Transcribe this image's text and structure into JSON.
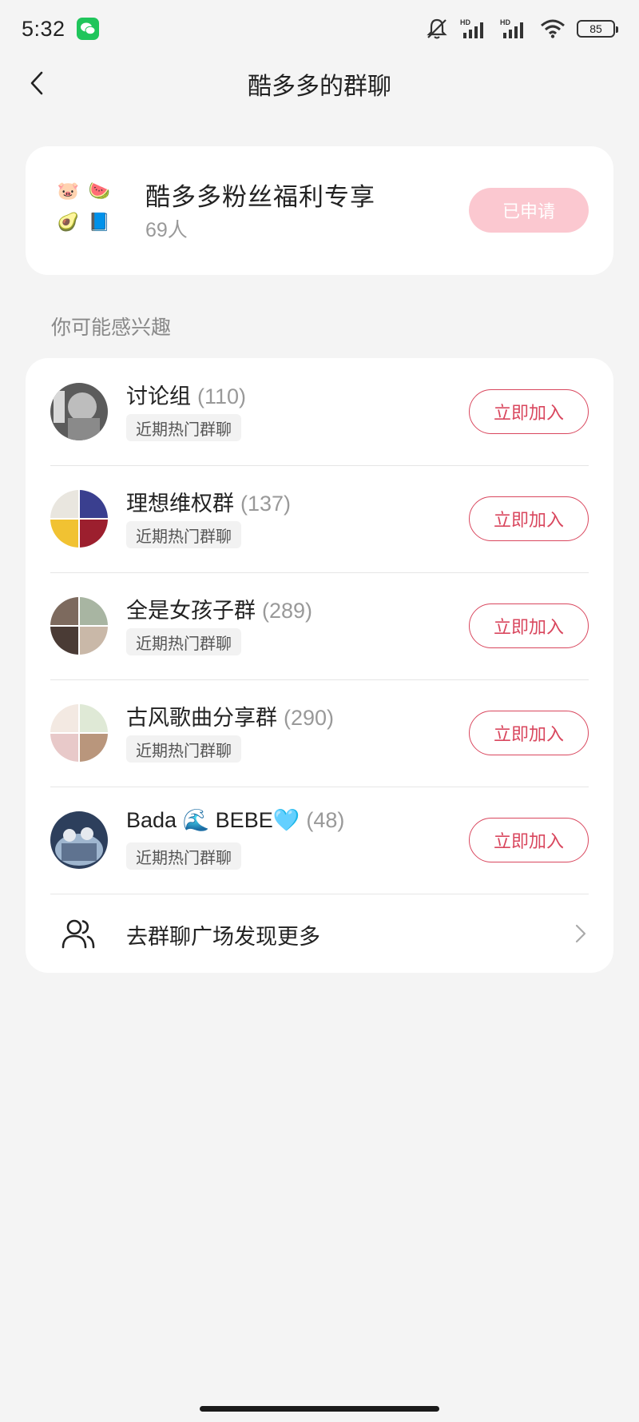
{
  "status_bar": {
    "time": "5:32",
    "battery": "85",
    "signal_1_label": "HD",
    "signal_2_label": "HD"
  },
  "header": {
    "title": "酷多多的群聊"
  },
  "my_group": {
    "name": "酷多多粉丝福利专享",
    "count": "69人",
    "button_label": "已申请",
    "mosaic": [
      "🐷",
      "🍉",
      "🥑",
      "📘"
    ]
  },
  "section_label": "你可能感兴趣",
  "groups": [
    {
      "name": "讨论组",
      "count": "(110)",
      "tag": "近期热门群聊",
      "button_label": "立即加入",
      "avatar_colors": [
        "#5b5b5b",
        "#bdbdbd",
        "#8a8a8a",
        "#d8d8d8"
      ]
    },
    {
      "name": "理想维权群",
      "count": "(137)",
      "tag": "近期热门群聊",
      "button_label": "立即加入",
      "avatar_colors": [
        "#e9e6df",
        "#3a3f8f",
        "#f1c232",
        "#9c1f2e"
      ]
    },
    {
      "name": "全是女孩子群",
      "count": "(289)",
      "tag": "近期热门群聊",
      "button_label": "立即加入",
      "avatar_colors": [
        "#7d6a5e",
        "#a8b5a2",
        "#4a3b35",
        "#c9b8a8"
      ]
    },
    {
      "name": "古风歌曲分享群",
      "count": "(290)",
      "tag": "近期热门群聊",
      "button_label": "立即加入",
      "avatar_colors": [
        "#f3e9e2",
        "#dfe9d6",
        "#e8c9c9",
        "#b9967c"
      ]
    },
    {
      "name": "Bada 🌊 BEBE🩵",
      "count": "(48)",
      "tag": "近期热门群聊",
      "button_label": "立即加入",
      "avatar_colors": [
        "#2d3f5c",
        "#9fb6cf",
        "#e5e9ef",
        "#5f7390"
      ]
    }
  ],
  "more": {
    "label": "去群聊广场发现更多"
  },
  "colors": {
    "accent": "#d9475e",
    "applied_bg": "#fbc8d0",
    "background": "#f4f4f4"
  }
}
